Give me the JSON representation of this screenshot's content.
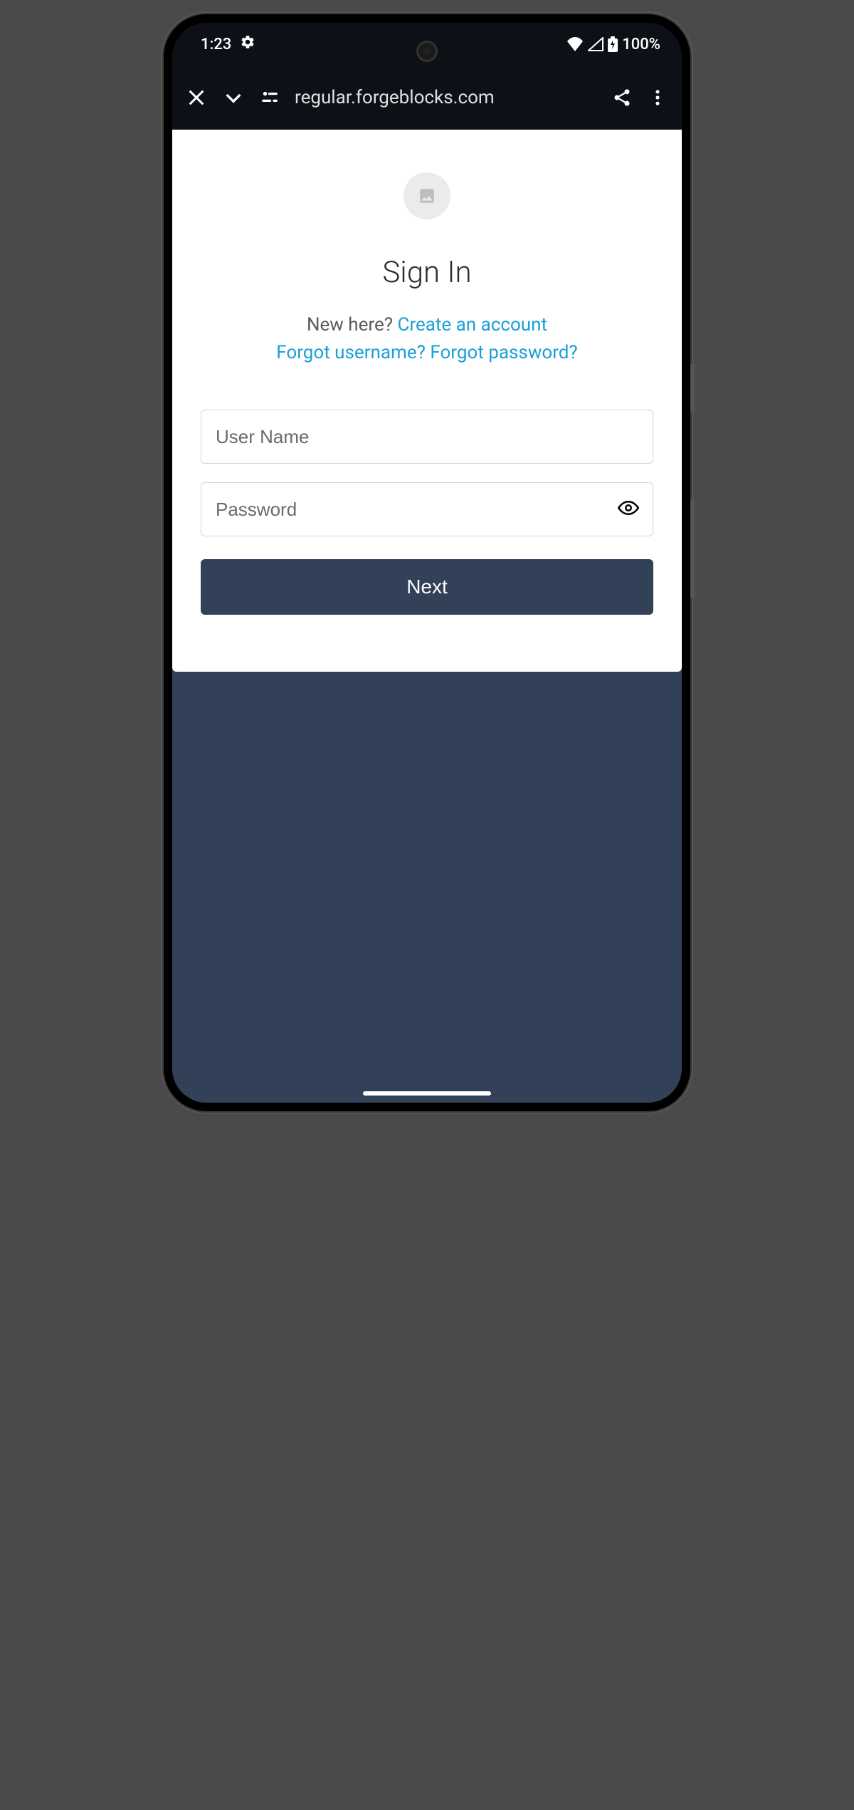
{
  "status_bar": {
    "time": "1:23",
    "battery_text": "100%"
  },
  "browser_bar": {
    "url": "regular.forgeblocks.com"
  },
  "signin": {
    "title": "Sign In",
    "new_here": "New here? ",
    "create_account": "Create an account",
    "forgot_username": "Forgot username?",
    "forgot_password": "Forgot password?",
    "username_placeholder": "User Name",
    "password_placeholder": "Password",
    "next_label": "Next"
  }
}
